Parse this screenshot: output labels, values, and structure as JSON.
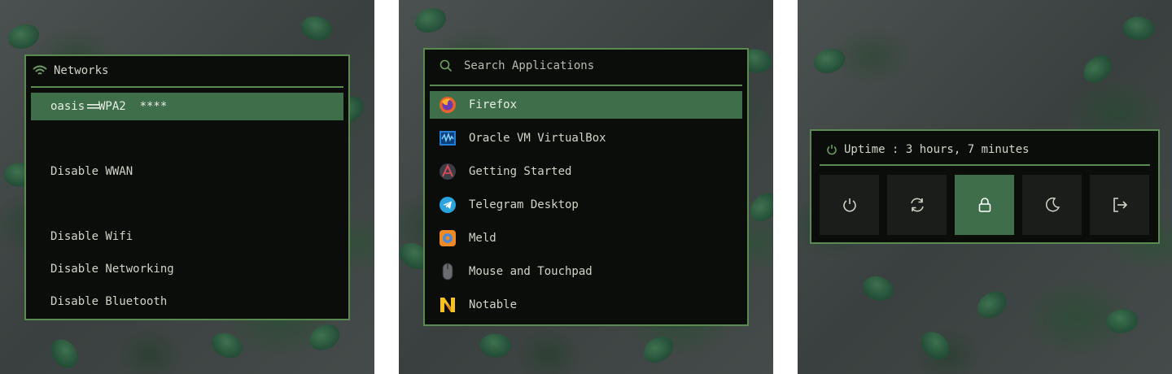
{
  "networks": {
    "title": "Networks",
    "items": [
      {
        "label": "oasis  WPA2  ****",
        "selected": true,
        "prefix": "=="
      },
      {
        "label": "Disable WWAN",
        "selected": false
      },
      {
        "label": "Disable Wifi",
        "selected": false
      },
      {
        "label": "Disable Networking",
        "selected": false
      },
      {
        "label": "Disable Bluetooth",
        "selected": false
      }
    ]
  },
  "launcher": {
    "search_placeholder": "Search Applications",
    "apps": [
      {
        "label": "Firefox",
        "icon": "firefox-icon",
        "selected": true
      },
      {
        "label": "Oracle VM VirtualBox",
        "icon": "virtualbox-icon",
        "selected": false
      },
      {
        "label": "Getting Started",
        "icon": "getting-started-icon",
        "selected": false
      },
      {
        "label": "Telegram Desktop",
        "icon": "telegram-icon",
        "selected": false
      },
      {
        "label": "Meld",
        "icon": "meld-icon",
        "selected": false
      },
      {
        "label": "Mouse and Touchpad",
        "icon": "mouse-icon",
        "selected": false
      },
      {
        "label": "Notable",
        "icon": "notable-icon",
        "selected": false
      }
    ]
  },
  "power": {
    "uptime": "Uptime : 3 hours, 7 minutes",
    "buttons": [
      {
        "icon": "power-icon",
        "selected": false
      },
      {
        "icon": "reboot-icon",
        "selected": false
      },
      {
        "icon": "lock-icon",
        "selected": true
      },
      {
        "icon": "sleep-icon",
        "selected": false
      },
      {
        "icon": "logout-icon",
        "selected": false
      }
    ]
  },
  "colors": {
    "accent": "#5a8a4f",
    "selection": "#3f6e4b",
    "window_bg": "#0b0d0b",
    "text": "#cfd6c8",
    "button_bg": "#1b1d1b"
  }
}
